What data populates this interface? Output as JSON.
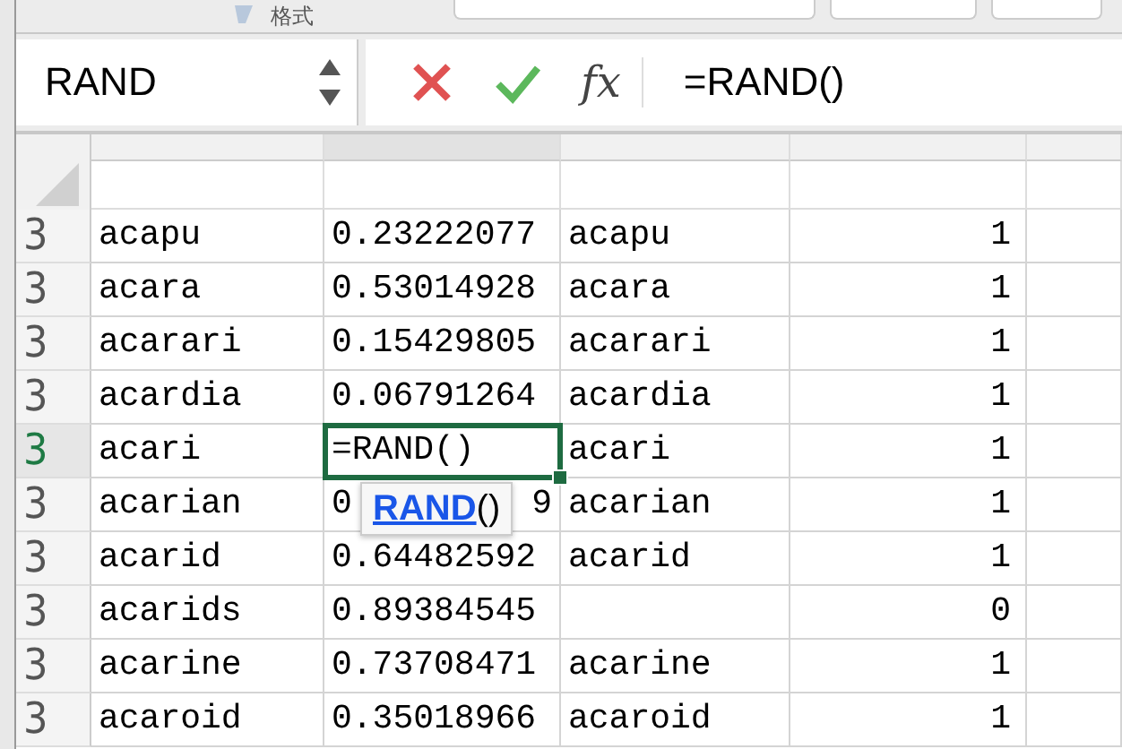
{
  "toolbar": {
    "label": "格式"
  },
  "formula_bar": {
    "name_box": "RAND",
    "fx_label": "fx",
    "formula": "=RAND()"
  },
  "autocomplete": {
    "text": "**RAND**()"
  },
  "rows": [
    {
      "header": "3",
      "selected": false,
      "a": "acapu",
      "b": "0.23222077",
      "c": "acapu",
      "d": "1"
    },
    {
      "header": "3",
      "selected": false,
      "a": "acara",
      "b": "0.53014928",
      "c": "acara",
      "d": "1"
    },
    {
      "header": "3",
      "selected": false,
      "a": "acarari",
      "b": "0.15429805",
      "c": "acarari",
      "d": "1"
    },
    {
      "header": "3",
      "selected": false,
      "a": "acardia",
      "b": "0.06791264",
      "c": "acardia",
      "d": "1"
    },
    {
      "header": "3",
      "selected": true,
      "a": "acari",
      "b": "=RAND()",
      "c": "acari",
      "d": "1"
    },
    {
      "header": "3",
      "selected": false,
      "a": "acarian",
      "b_parts": [
        "0",
        "9"
      ],
      "c": "acarian",
      "d": "1"
    },
    {
      "header": "3",
      "selected": false,
      "a": "acarid",
      "b": "0.64482592",
      "c": "acarid",
      "d": "1"
    },
    {
      "header": "3",
      "selected": false,
      "a": "acarids",
      "b": "0.89384545",
      "d": "0"
    },
    {
      "header": "3",
      "selected": false,
      "a": "acarine",
      "b": "0.73708471",
      "c": "acarine",
      "d": "1"
    },
    {
      "header": "3",
      "selected": false,
      "a": "acaroid",
      "b": "0.35018966",
      "c": "acaroid",
      "d": "1"
    }
  ]
}
